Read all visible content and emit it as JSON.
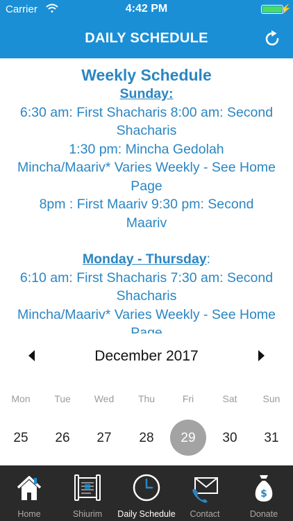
{
  "status_bar": {
    "carrier": "Carrier",
    "time": "4:42 PM",
    "battery_color": "#4cd964"
  },
  "nav_bar": {
    "title": "DAILY SCHEDULE",
    "background": "#1a8fd6",
    "right_icon": "refresh-icon"
  },
  "schedule": {
    "heading": "Weekly Schedule",
    "sections": [
      {
        "day": "Sunday:",
        "lines": [
          "6:30 am: First Shacharis 8:00 am: Second",
          "Shacharis",
          "1:30 pm: Mincha Gedolah",
          "Mincha/Maariv* Varies Weekly - See Home",
          "Page",
          "8pm : First Maariv 9:30 pm: Second",
          "Maariv"
        ]
      },
      {
        "day": "Monday - Thursday",
        "day_suffix": ":",
        "lines": [
          "6:10 am: First Shacharis 7:30 am: Second",
          "Shacharis",
          "Mincha/Maariv* Varies Weekly - See Home",
          "Page"
        ]
      }
    ]
  },
  "calendar": {
    "month_label": "December 2017",
    "weekdays": [
      "Mon",
      "Tue",
      "Wed",
      "Thu",
      "Fri",
      "Sat",
      "Sun"
    ],
    "dates": [
      "25",
      "26",
      "27",
      "28",
      "29",
      "30",
      "31"
    ],
    "selected_date": "29"
  },
  "tab_bar": {
    "tabs": [
      {
        "label": "Home",
        "icon": "home-icon"
      },
      {
        "label": "Shiurim",
        "icon": "torah-scroll-icon"
      },
      {
        "label": "Daily Schedule",
        "icon": "clock-icon",
        "active": true
      },
      {
        "label": "Contact",
        "icon": "contact-mail-icon"
      },
      {
        "label": "Donate",
        "icon": "money-bag-icon"
      }
    ]
  }
}
